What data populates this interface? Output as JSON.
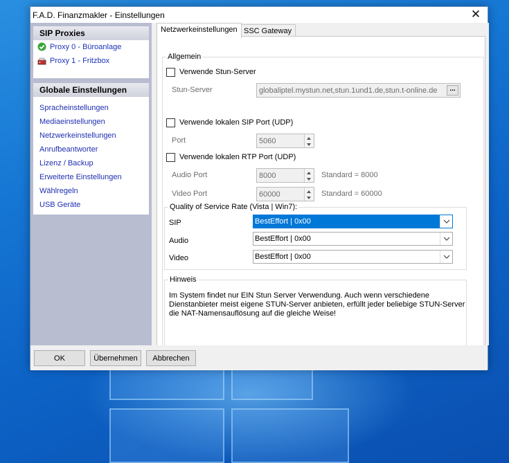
{
  "window": {
    "title": "F.A.D. Finanzmakler - Einstellungen"
  },
  "sidebar": {
    "sip_proxies_header": "SIP Proxies",
    "proxies": [
      {
        "label": "Proxy 0 - Büroanlage",
        "icon": "check-icon"
      },
      {
        "label": "Proxy 1 - Fritzbox",
        "icon": "router-icon"
      }
    ],
    "global_header": "Globale Einstellungen",
    "links": [
      "Spracheinstellungen",
      "Mediaeinstellungen",
      "Netzwerkeinstellungen",
      "Anrufbeantworter",
      "Lizenz / Backup",
      "Erweiterte Einstellungen",
      "Wählregeln",
      "USB Geräte"
    ]
  },
  "tabs": [
    "Netzwerkeinstellungen",
    "SSC Gateway"
  ],
  "general": {
    "legend": "Allgemein",
    "stun_checkbox": "Verwende Stun-Server",
    "stun_label": "Stun-Server",
    "stun_value": "globaliptel.mystun.net,stun.1und1.de,stun.t-online.de",
    "stun_browse": "...",
    "sip_checkbox": "Verwende lokalen SIP Port (UDP)",
    "port_label": "Port",
    "port_value": "5060",
    "rtp_checkbox": "Verwende lokalen RTP Port (UDP)",
    "audio_port_label": "Audio Port",
    "audio_port_value": "8000",
    "audio_standard": "Standard = 8000",
    "video_port_label": "Video Port",
    "video_port_value": "60000",
    "video_standard": "Standard = 60000"
  },
  "qos": {
    "legend": "Quality of Service Rate (Vista | Win7):",
    "rows": [
      {
        "label": "SIP",
        "value": "BestEffort | 0x00"
      },
      {
        "label": "Audio",
        "value": "BestEffort | 0x00"
      },
      {
        "label": "Video",
        "value": "BestEffort | 0x00"
      }
    ]
  },
  "hint": {
    "legend": "Hinweis",
    "text": "Im System findet nur EIN Stun Server Verwendung. Auch wenn verschiedene Dienstanbieter meist eigene STUN-Server anbieten, erfüllt jeder beliebige STUN-Server die NAT-Namensauflösung auf die gleiche Weise!"
  },
  "buttons": {
    "ok": "OK",
    "apply": "Übernehmen",
    "cancel": "Abbrechen"
  },
  "colors": {
    "selection": "#0078d7",
    "link": "#1f2fb0",
    "sidebar_bg": "#b9bdd0"
  }
}
